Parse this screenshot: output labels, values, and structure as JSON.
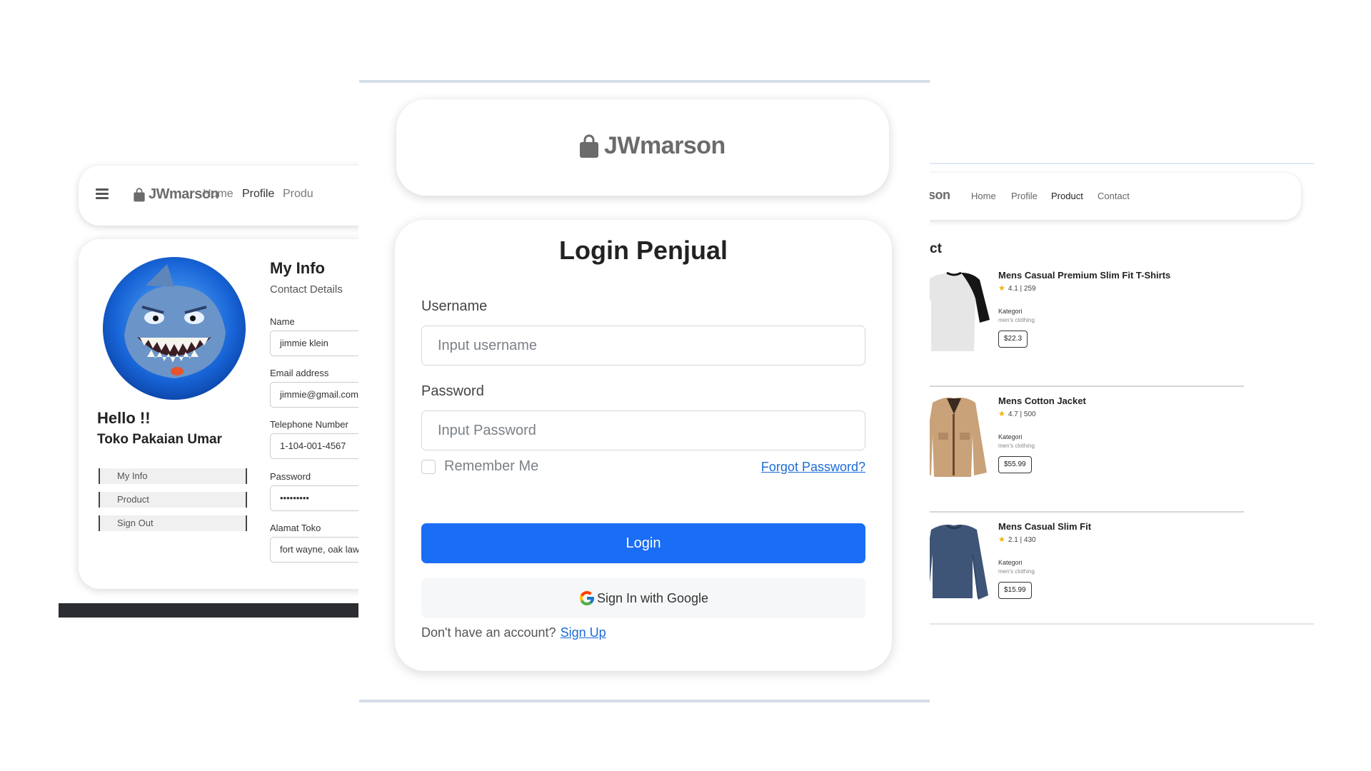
{
  "brand": {
    "name": "JWmarson",
    "icon": "shopping-bag-icon",
    "color": "#6b6b6b"
  },
  "left": {
    "menu_icon": "hamburger-icon",
    "nav": [
      "Home",
      "Profile",
      "Produ"
    ],
    "avatar_icon": "shark-avatar",
    "greeting": "Hello !!",
    "store_name": "Toko Pakaian Umar",
    "sidebar": [
      "My Info",
      "Product",
      "Sign Out"
    ],
    "title": "My Info",
    "subtitle": "Contact Details",
    "fields": [
      {
        "label": "Name",
        "value": "jimmie klein"
      },
      {
        "label": "Email address",
        "value": "jimmie@gmail.com"
      },
      {
        "label": "Telephone Number",
        "value": "1-104-001-4567"
      },
      {
        "label": "Password",
        "value": "•••••••••"
      },
      {
        "label": "Alamat Toko",
        "value": "fort wayne, oak lawn"
      }
    ]
  },
  "login": {
    "title": "Login Penjual",
    "username_label": "Username",
    "username_placeholder": "Input username",
    "password_label": "Password",
    "password_placeholder": "Input Password",
    "remember": "Remember Me",
    "forgot": "Forgot Password?",
    "login_button": "Login",
    "google_button": "Sign In with Google",
    "no_account": "Don't have an account?",
    "signup": "Sign Up",
    "accent_color": "#1a6df5",
    "link_color": "#1c6cd6"
  },
  "right": {
    "brand_partial": "arson",
    "nav": [
      "Home",
      "Profile",
      "Product",
      "Contact"
    ],
    "heading": "ct",
    "category_label": "Kategori",
    "products": [
      {
        "name": "Mens Casual Premium Slim Fit T-Shirts",
        "rating": "4.1 | 259",
        "category": "men's clothing",
        "price": "$22.3",
        "image": "raglan-tshirt-image"
      },
      {
        "name": "Mens Cotton Jacket",
        "rating": "4.7 | 500",
        "category": "men's clothing",
        "price": "$55.99",
        "image": "cotton-jacket-image"
      },
      {
        "name": "Mens Casual Slim Fit",
        "rating": "2.1 | 430",
        "category": "men's clothing",
        "price": "$15.99",
        "image": "navy-longsleeve-image"
      }
    ]
  }
}
